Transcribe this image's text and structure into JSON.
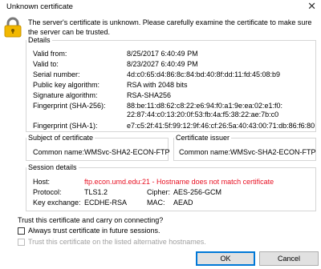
{
  "window": {
    "title": "Unknown certificate",
    "close_glyph": "✕"
  },
  "message": "The server's certificate is unknown. Please carefully examine the certificate to make sure the server can be trusted.",
  "details": {
    "legend": "Details",
    "rows": [
      {
        "label": "Valid from:",
        "value": "8/25/2017 6:40:49 PM"
      },
      {
        "label": "Valid to:",
        "value": "8/23/2027 6:40:49 PM"
      },
      {
        "label": "Serial number:",
        "value": "4d:c0:65:d4:86:8c:84:bd:40:8f:dd:11:fd:45:08:b9"
      },
      {
        "label": "Public key algorithm:",
        "value": "RSA with 2048 bits"
      },
      {
        "label": "Signature algorithm:",
        "value": "RSA-SHA256"
      },
      {
        "label": "Fingerprint (SHA-256):",
        "value": "88:be:11:d8:62:c8:22:e6:94:f0:a1:9e:ea:02:e1:f0:",
        "value2": "22:87:44:c0:13:20:0f:53:fb:4a:f5:38:22:ae:7b:c0"
      },
      {
        "label": "Fingerprint (SHA-1):",
        "value": "e7:c5:2f:41:5f:99:12:9f:46:cf:26:5a:40:43:00:71:db:86:f6:80"
      }
    ]
  },
  "subject": {
    "legend": "Subject of certificate",
    "label": "Common name:",
    "value": "WMSvc-SHA2-ECON-FTP"
  },
  "issuer": {
    "legend": "Certificate issuer",
    "label": "Common name:",
    "value": "WMSvc-SHA2-ECON-FTP"
  },
  "session": {
    "legend": "Session details",
    "host_label": "Host:",
    "host_value": "ftp.econ.umd.edu:21 - Hostname does not match certificate",
    "protocol_label": "Protocol:",
    "protocol_value": "TLS1.2",
    "cipher_label": "Cipher:",
    "cipher_value": "AES-256-GCM",
    "kex_label": "Key exchange:",
    "kex_value": "ECDHE-RSA",
    "mac_label": "MAC:",
    "mac_value": "AEAD"
  },
  "question": "Trust this certificate and carry on connecting?",
  "options": {
    "always_trust": "Always trust certificate in future sessions.",
    "alt_hostnames": "Trust this certificate on the listed alternative hostnames."
  },
  "buttons": {
    "ok": "OK",
    "cancel": "Cancel"
  },
  "colors": {
    "warning": "#e81123",
    "lock_body": "#f2b800",
    "lock_shackle": "#7a7a7a",
    "default_button_border": "#0078d7"
  }
}
